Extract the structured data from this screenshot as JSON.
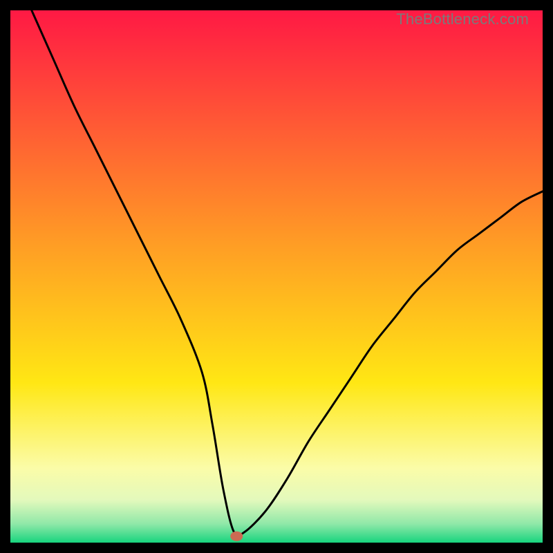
{
  "watermark": "TheBottleneck.com",
  "chart_data": {
    "type": "line",
    "title": "",
    "xlabel": "",
    "ylabel": "",
    "xlim": [
      0,
      100
    ],
    "ylim": [
      0,
      100
    ],
    "background_gradient": {
      "stops": [
        {
          "offset": 0,
          "color": "#ff1944"
        },
        {
          "offset": 0.45,
          "color": "#ffa024"
        },
        {
          "offset": 0.7,
          "color": "#ffe714"
        },
        {
          "offset": 0.86,
          "color": "#fbfca8"
        },
        {
          "offset": 0.92,
          "color": "#e3f9bc"
        },
        {
          "offset": 0.965,
          "color": "#8fe8a8"
        },
        {
          "offset": 1.0,
          "color": "#18d47e"
        }
      ]
    },
    "series": [
      {
        "name": "bottleneck-curve",
        "x": [
          4,
          8,
          12,
          16,
          20,
          24,
          28,
          32,
          36,
          38,
          40,
          42,
          44,
          48,
          52,
          56,
          60,
          64,
          68,
          72,
          76,
          80,
          84,
          88,
          92,
          96,
          100
        ],
        "y": [
          100,
          91,
          82,
          74,
          66,
          58,
          50,
          42,
          32,
          22,
          10,
          2,
          2,
          6,
          12,
          19,
          25,
          31,
          37,
          42,
          47,
          51,
          55,
          58,
          61,
          64,
          66
        ]
      }
    ],
    "marker": {
      "x": 42.5,
      "y": 1.2,
      "color": "#cc6a53"
    }
  }
}
